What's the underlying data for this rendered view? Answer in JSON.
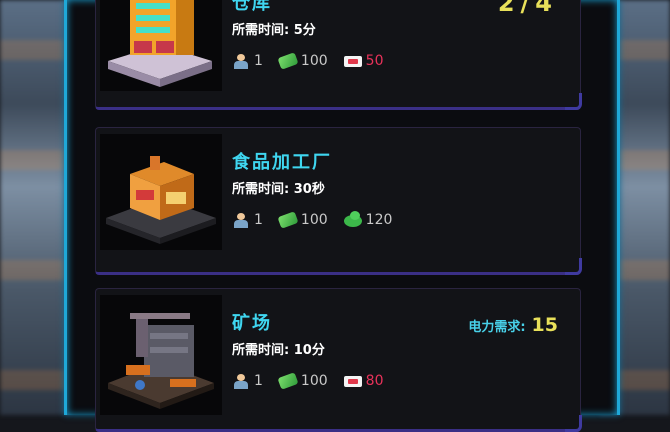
{
  "buildings": [
    {
      "name": "仓库",
      "time_label": "所需时间: 5分",
      "workers": "1",
      "cash": "100",
      "resource_icon": "ticket-icon",
      "resource_value": "50",
      "resource_color": "#e8325a",
      "count": "2/4"
    },
    {
      "name": "食品加工厂",
      "time_label": "所需时间: 30秒",
      "workers": "1",
      "cash": "100",
      "resource_icon": "leaf-icon",
      "resource_value": "120",
      "resource_color": "#c9c9c9"
    },
    {
      "name": "矿场",
      "time_label": "所需时间: 10分",
      "workers": "1",
      "cash": "100",
      "resource_icon": "ticket-icon",
      "resource_value": "80",
      "resource_color": "#e8325a",
      "power_label": "电力需求:",
      "power_value": "15"
    }
  ],
  "colors": {
    "frame": "#1fa8d8",
    "title": "#3fd6f0",
    "accent": "#e8e05a"
  }
}
